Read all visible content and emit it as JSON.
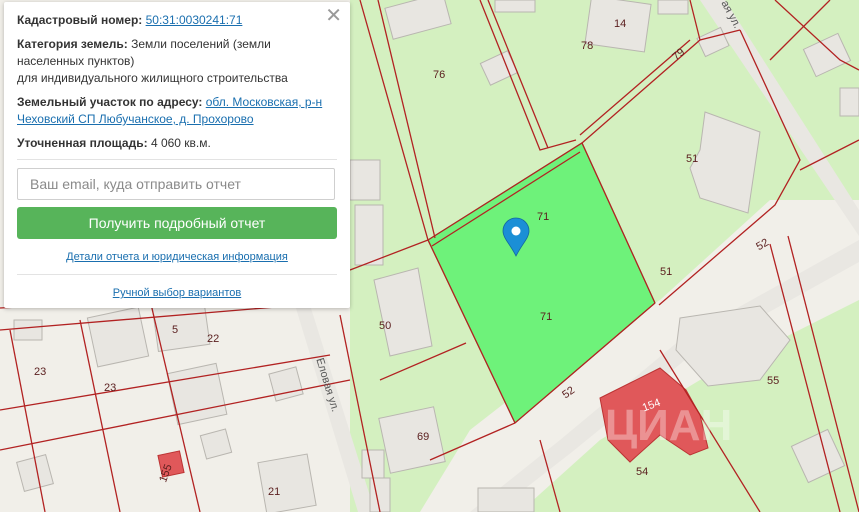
{
  "panel": {
    "close_glyph": "✕",
    "cadastral_label": "Кадастровый номер:",
    "cadastral_value": "50:31:0030241:71",
    "category_label": "Категория земель:",
    "category_value": "Земли поселений (земли населенных пунктов)",
    "category_purpose": "для индивидуального жилищного строительства",
    "address_label": "Земельный участок по адресу:",
    "address_value": "обл. Московская, р-н Чеховский СП Любучанское, д. Прохорово",
    "area_label": "Уточненная площадь:",
    "area_value": "4 060 кв.м.",
    "email_placeholder": "Ваш email, куда отправить отчет",
    "get_report_button": "Получить подробный отчет",
    "details_link": "Детали отчета и юридическая информация",
    "manual_link": "Ручной выбор вариантов"
  },
  "map": {
    "colors": {
      "background": "#f1efe9",
      "green_zone": "#d4f0c0",
      "selected_parcel": "#6ef27a",
      "boundary": "#b22222",
      "building": "#e8e6e1",
      "highlight_building": "#e0585a",
      "pin": "#1b8fd6"
    },
    "streets": [
      "Еловая ул.",
      "ая ул."
    ],
    "parcel_labels": [
      "14",
      "78",
      "79",
      "76",
      "51",
      "71",
      "71",
      "52",
      "51",
      "50",
      "55",
      "69",
      "52",
      "154",
      "54",
      "5",
      "22",
      "23",
      "23",
      "21",
      "155"
    ],
    "watermark": "ЦИАН"
  }
}
